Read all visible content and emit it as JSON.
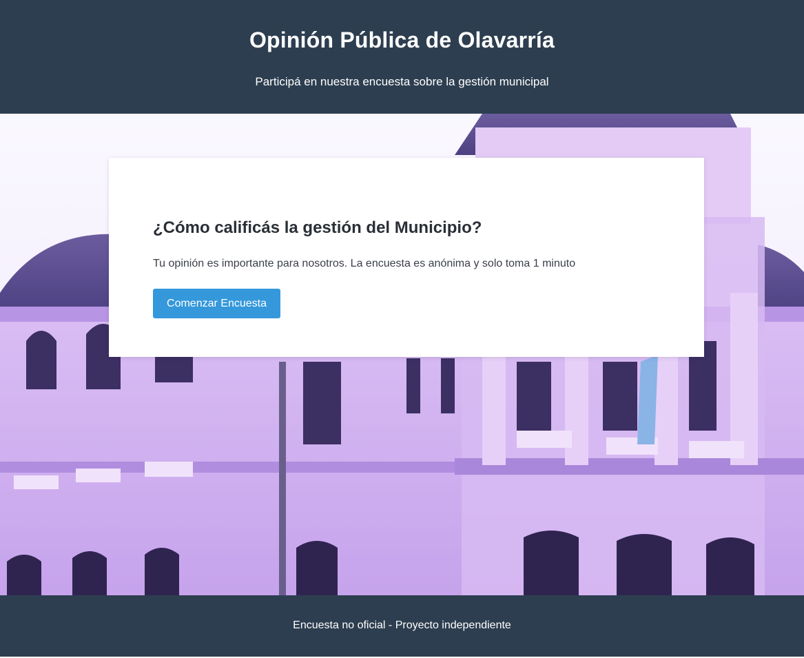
{
  "header": {
    "title": "Opinión Pública de Olavarría",
    "subtitle": "Participá en nuestra encuesta sobre la gestión municipal"
  },
  "hero": {
    "image": "municipal-palace-photo"
  },
  "card": {
    "heading": "¿Cómo calificás la gestión del Municipio?",
    "description": "Tu opinión es importante para nosotros. La encuesta es anónima y solo toma 1 minuto",
    "start_button": "Comenzar Encuesta"
  },
  "footer": {
    "text": "Encuesta no oficial - Proyecto independiente"
  },
  "colors": {
    "header_bg": "#2d3e50",
    "button_bg": "#3498db",
    "hero_tint": "#c9a6f0"
  }
}
